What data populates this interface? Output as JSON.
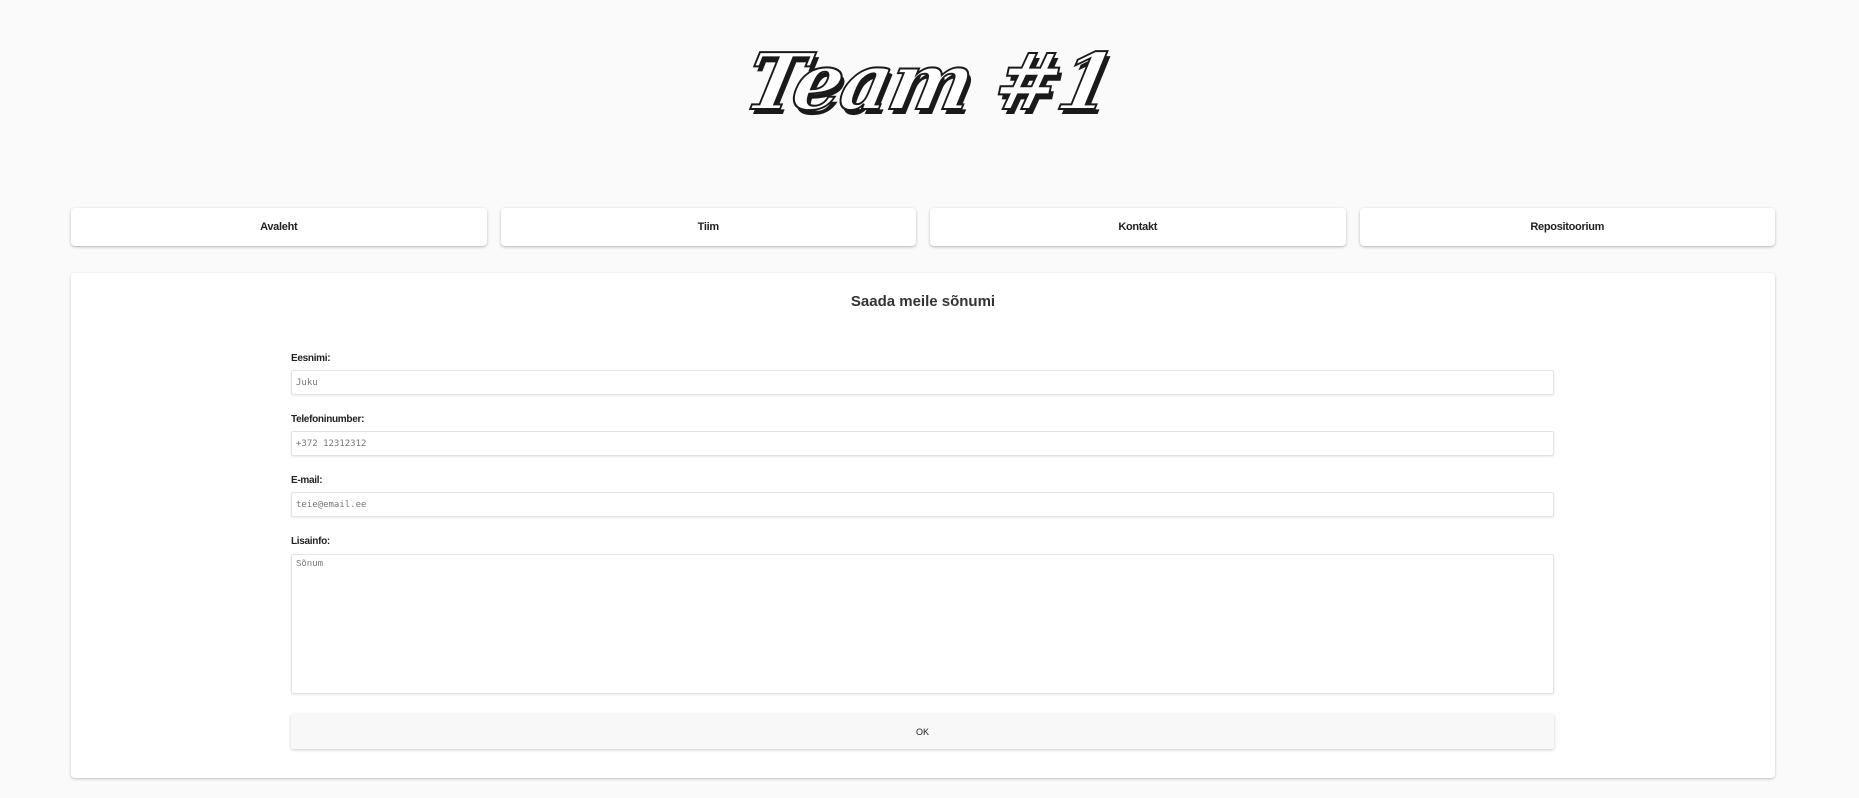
{
  "header": {
    "logo_text": "Team #1"
  },
  "nav": {
    "items": [
      {
        "label": "Avaleht"
      },
      {
        "label": "Tiim"
      },
      {
        "label": "Kontakt"
      },
      {
        "label": "Repositoorium"
      }
    ]
  },
  "contact_form": {
    "title": "Saada meile sõnumi",
    "first_name": {
      "label": "Eesnimi:",
      "placeholder": "Juku",
      "value": ""
    },
    "phone": {
      "label": "Telefoninumber:",
      "placeholder": "+372 12312312",
      "value": ""
    },
    "email": {
      "label": "E-mail:",
      "placeholder": "teie@email.ee",
      "value": ""
    },
    "extra_info": {
      "label": "Lisainfo:",
      "placeholder": "Sõnum",
      "value": ""
    },
    "submit_label": "OK"
  }
}
